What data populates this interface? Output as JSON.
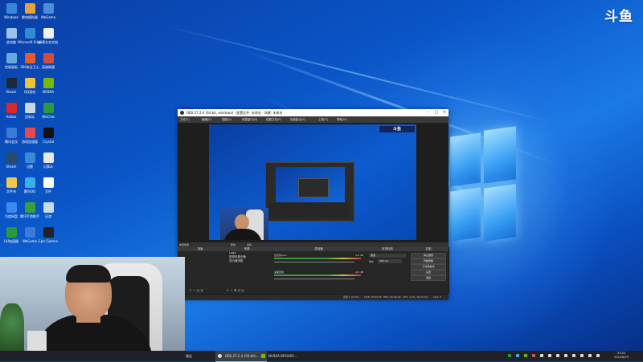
{
  "watermark": {
    "brand": "斗鱼"
  },
  "desktop_icons": [
    {
      "label": "Windows",
      "color": "#3a86d8"
    },
    {
      "label": "雷电模拟器",
      "color": "#e8a23a"
    },
    {
      "label": "WeGame",
      "color": "#4a8fd8"
    },
    {
      "label": "此电脑",
      "color": "#9bc3e8"
    },
    {
      "label": "Microsoft Edge",
      "color": "#2f8ad8"
    },
    {
      "label": "新建文本文档",
      "color": "#f0f0f0"
    },
    {
      "label": "控制面板",
      "color": "#6aa9e0"
    },
    {
      "label": "360安全卫士",
      "color": "#e85a2a"
    },
    {
      "label": "英雄联盟",
      "color": "#d84a3a"
    },
    {
      "label": "Steam",
      "color": "#1b2838"
    },
    {
      "label": "QQ游戏",
      "color": "#f0c23a"
    },
    {
      "label": "NVIDIA",
      "color": "#76b900"
    },
    {
      "label": "Adobe",
      "color": "#d82a2a"
    },
    {
      "label": "回收站",
      "color": "#c8d8e8"
    },
    {
      "label": "WeChat",
      "color": "#2a9a3a"
    },
    {
      "label": "腾讯会议",
      "color": "#3a7ad8"
    },
    {
      "label": "游戏加速器",
      "color": "#e84a4a"
    },
    {
      "label": "Crystal",
      "color": "#111111"
    },
    {
      "label": "Steam",
      "color": "#2a4a6a"
    },
    {
      "label": "迅雷",
      "color": "#3a8ad8"
    },
    {
      "label": "记事本",
      "color": "#e8e8e8"
    },
    {
      "label": "文件夹",
      "color": "#f0c850"
    },
    {
      "label": "腾讯QQ",
      "color": "#3ab0e8"
    },
    {
      "label": "文件",
      "color": "#ffffff"
    },
    {
      "label": "百度网盘",
      "color": "#3a8af0"
    },
    {
      "label": "腾讯手游助手",
      "color": "#3aa03a"
    },
    {
      "label": "迅游",
      "color": "#c8dce8"
    },
    {
      "label": "UU加速器",
      "color": "#2a9a3a"
    },
    {
      "label": "WeGame",
      "color": "#3a7ad8"
    },
    {
      "label": "Epic Games",
      "color": "#222222"
    }
  ],
  "obs": {
    "title": "OBS 27.2.4 (64-bit, windows) - 配置文件: 未命名 - 场景: 未命名",
    "menu": [
      "文件(F)",
      "编辑(E)",
      "视图(V)",
      "停靠窗口(D)",
      "配置文件(P)",
      "场景集合(S)",
      "工具(T)",
      "帮助(H)"
    ],
    "no_source": "未选择源",
    "properties": "属性",
    "filters": "滤镜",
    "docks": {
      "scenes": "场景",
      "sources": "来源",
      "mixer": "混音器",
      "transitions": "转场特效",
      "controls": "控制"
    },
    "scene_items": [
      "场景"
    ],
    "source_items": [
      "Logo",
      "视频采集设备",
      "显示器采集"
    ],
    "mixer_channels": [
      {
        "name": "麦克风/Aux",
        "level_db": "0.0 dB"
      },
      {
        "name": "桌面音频",
        "level_db": "-4.9 dB"
      }
    ],
    "transition": {
      "type": "渐变",
      "duration_label": "时长",
      "duration": "300 ms"
    },
    "controls": [
      "停止推流",
      "开始录制",
      "工作室模式",
      "设置",
      "退出"
    ],
    "status": {
      "dropped": "丢帧 0 (0.0%)",
      "live": "LIVE: 00:00:00",
      "rec": "REC: 00:00:00",
      "cpu": "CPU: 1.0%, 60.00 fps",
      "kbps": "kb/s: 0"
    }
  },
  "taskbar": {
    "items": [
      "微信",
      "OBS 27.2.4 (64-bit)...",
      "NVIDIA BROADC..."
    ],
    "time": "23:00",
    "date": "2022/6/29"
  }
}
